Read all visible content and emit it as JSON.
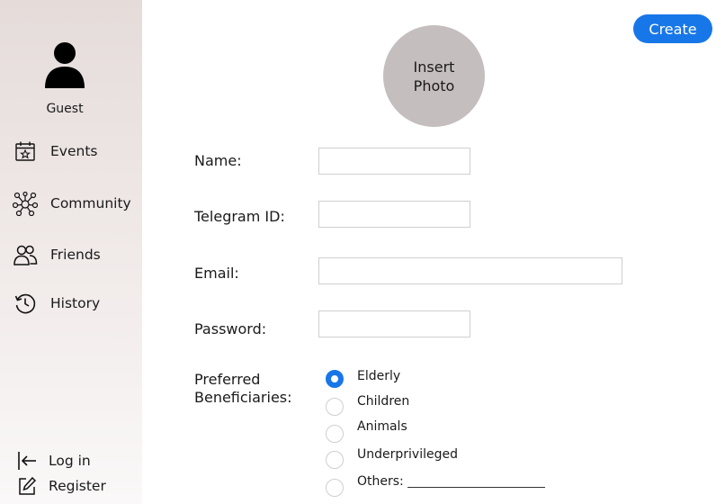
{
  "sidebar": {
    "user": {
      "name": "Guest",
      "icon": "user-avatar-icon"
    },
    "nav": [
      {
        "label": "Events",
        "icon": "calendar-star-icon"
      },
      {
        "label": "Community",
        "icon": "network-icon"
      },
      {
        "label": "Friends",
        "icon": "people-icon"
      },
      {
        "label": "History",
        "icon": "history-clock-icon"
      }
    ],
    "bottom": [
      {
        "label": "Log in",
        "icon": "login-arrow-icon"
      },
      {
        "label": "Register",
        "icon": "edit-icon"
      }
    ]
  },
  "header": {
    "create_label": "Create"
  },
  "photo": {
    "label": "Insert\nPhoto"
  },
  "form": {
    "name": {
      "label": "Name:",
      "value": ""
    },
    "telegram": {
      "label": "Telegram ID:",
      "value": ""
    },
    "email": {
      "label": "Email:",
      "value": ""
    },
    "password": {
      "label": "Password:",
      "value": ""
    }
  },
  "preferred": {
    "label": "Preferred Beneficiaries:",
    "selected": "Elderly",
    "options": [
      "Elderly",
      "Children",
      "Animals",
      "Underprivileged",
      "Others:"
    ]
  },
  "colors": {
    "accent": "#1877e8",
    "photo_bg": "#c5bebe",
    "sidebar_top": "#e5dcda"
  }
}
